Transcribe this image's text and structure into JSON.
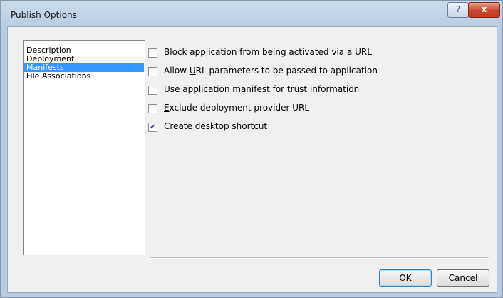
{
  "window": {
    "title": "Publish Options",
    "help_label": "?",
    "close_label": "x"
  },
  "nav": {
    "items": [
      {
        "label": "Description",
        "selected": false
      },
      {
        "label": "Deployment",
        "selected": false
      },
      {
        "label": "Manifests",
        "selected": true
      },
      {
        "label": "File Associations",
        "selected": false
      }
    ]
  },
  "options": [
    {
      "label_before": "Bloc",
      "mnemonic": "k",
      "label_after": " application from being activated via a URL",
      "checked": false
    },
    {
      "label_before": "Allow ",
      "mnemonic": "U",
      "label_after": "RL parameters to be passed to application",
      "checked": false
    },
    {
      "label_before": "Use ",
      "mnemonic": "a",
      "label_after": "pplication manifest for trust information",
      "checked": false
    },
    {
      "label_before": "",
      "mnemonic": "E",
      "label_after": "xclude deployment provider URL",
      "checked": false
    },
    {
      "label_before": "",
      "mnemonic": "C",
      "label_after": "reate desktop shortcut",
      "checked": true
    }
  ],
  "buttons": {
    "ok_label": "OK",
    "cancel_label": "Cancel"
  },
  "colors": {
    "selection": "#3399ff",
    "close_button": "#c9452a"
  }
}
